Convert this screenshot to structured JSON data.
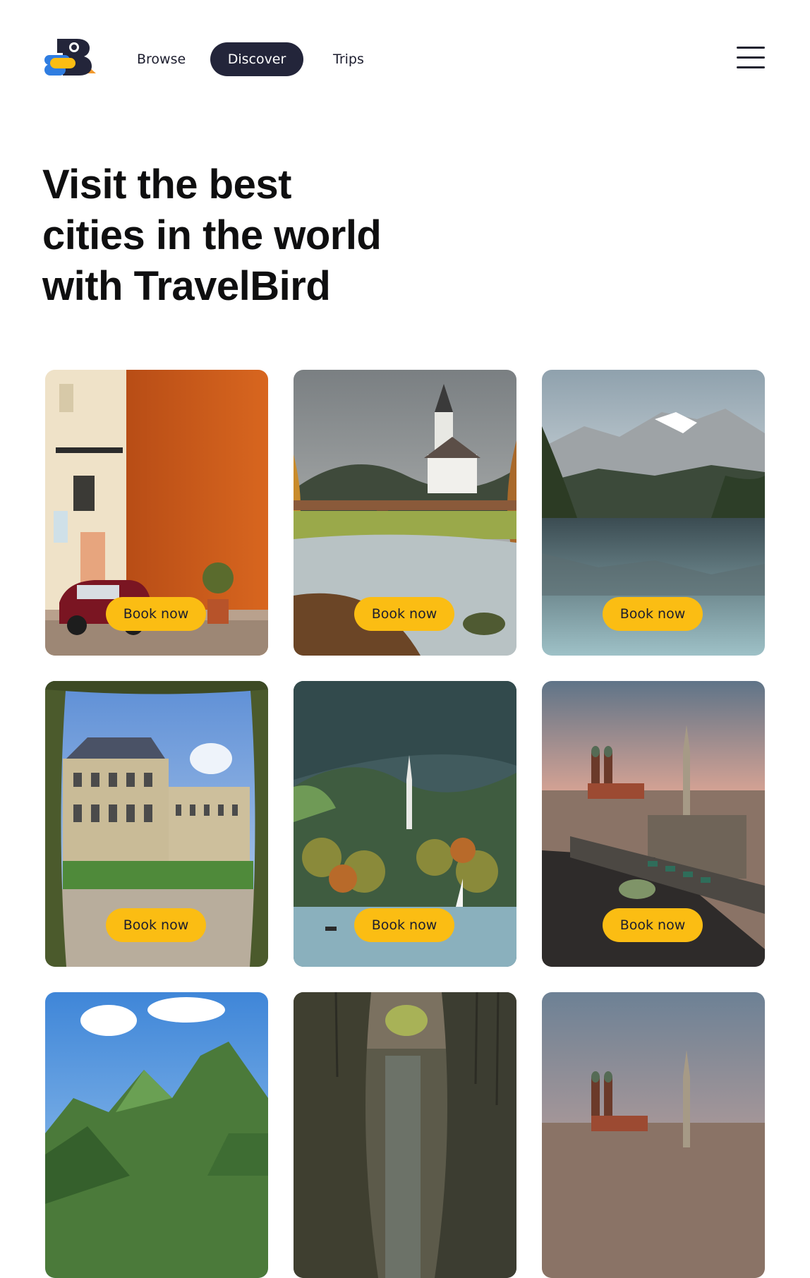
{
  "brand": {
    "name": "TravelBird",
    "colors": {
      "dark": "#23253a",
      "yellow": "#fbbd13",
      "blue": "#2f7de1",
      "orange": "#f29a2e"
    }
  },
  "nav": {
    "items": [
      {
        "label": "Browse",
        "active": false
      },
      {
        "label": "Discover",
        "active": true
      },
      {
        "label": "Trips",
        "active": false
      }
    ],
    "menu_icon": "hamburger-menu-icon"
  },
  "hero": {
    "line1": "Visit the best",
    "line2": "cities in the world",
    "line3": "with TravelBird"
  },
  "cards": [
    {
      "photo": "orange-wall-vintage-car",
      "button": "Book now"
    },
    {
      "photo": "church-wooden-bridge-stream",
      "button": "Book now"
    },
    {
      "photo": "alpine-lake-reflection",
      "button": "Book now"
    },
    {
      "photo": "baroque-palace-garden",
      "button": "Book now"
    },
    {
      "photo": "lakeside-village-sailboat",
      "button": "Book now"
    },
    {
      "photo": "city-aerial-twin-towers",
      "button": "Book now"
    },
    {
      "photo": "green-mountain-valley",
      "button": null
    },
    {
      "photo": "forest-gorge",
      "button": null
    },
    {
      "photo": "city-skyline-sunset",
      "button": null
    }
  ]
}
